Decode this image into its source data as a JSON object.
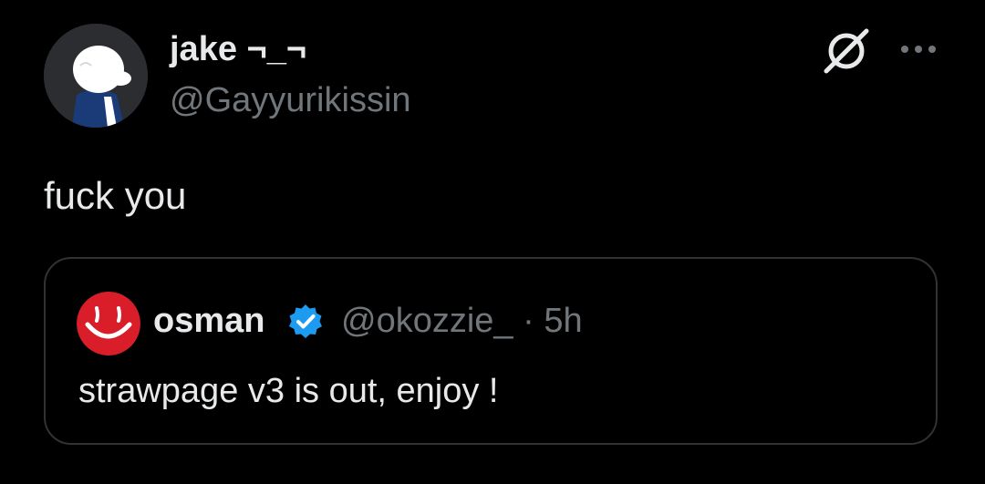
{
  "tweet": {
    "author_name": "jake ¬_¬",
    "author_handle": "@Gayyurikissin",
    "text": "fuck you",
    "icons": {
      "avatar": "white-cartoon-character-avatar",
      "grok": "grok-icon",
      "more": "more-options-icon"
    }
  },
  "quoted_tweet": {
    "author_name": "osman",
    "author_handle": "@okozzie_",
    "time_meta": "@okozzie_ · 5h",
    "text": "strawpage v3 is out, enjoy !",
    "verified": true,
    "icons": {
      "avatar": "red-smiley-avatar",
      "verified": "verified-badge-icon"
    }
  },
  "colors": {
    "background": "#000000",
    "primary_text": "#e7e9ea",
    "secondary_text": "#71767b",
    "border": "#2f3336",
    "verified_blue": "#1d9bf0",
    "smiley_red": "#d91e2a"
  }
}
